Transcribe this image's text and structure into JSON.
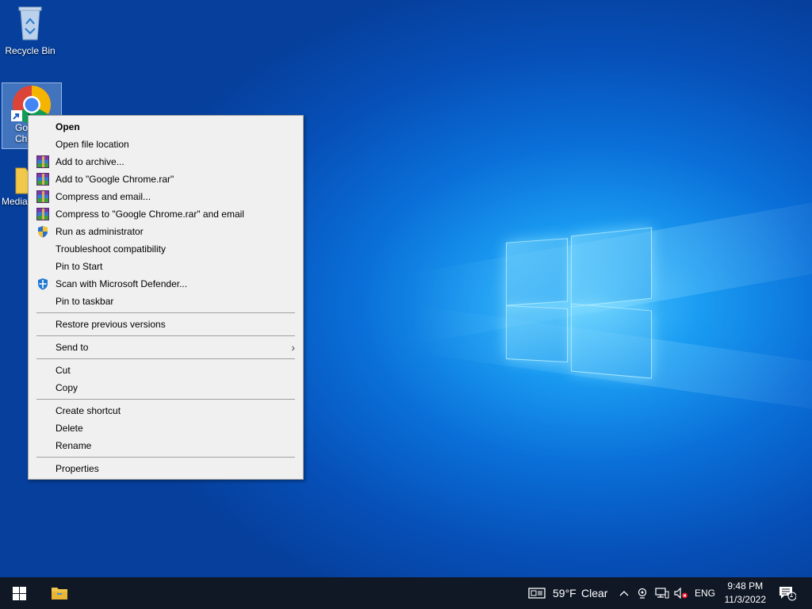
{
  "desktop": {
    "icons": [
      {
        "label": "Recycle Bin"
      },
      {
        "label": "Google Chrome",
        "label_visible": "Go\nChr"
      },
      {
        "label": "Media"
      }
    ]
  },
  "context_menu": {
    "groups": [
      [
        {
          "label": "Open",
          "bold": true
        },
        {
          "label": "Open file location"
        },
        {
          "label": "Add to archive...",
          "icon": "winrar-icon"
        },
        {
          "label": "Add to \"Google Chrome.rar\"",
          "icon": "winrar-icon"
        },
        {
          "label": "Compress and email...",
          "icon": "winrar-icon"
        },
        {
          "label": "Compress to \"Google Chrome.rar\" and email",
          "icon": "winrar-icon"
        },
        {
          "label": "Run as administrator",
          "icon": "uac-shield-icon"
        },
        {
          "label": "Troubleshoot compatibility"
        },
        {
          "label": "Pin to Start"
        },
        {
          "label": "Scan with Microsoft Defender...",
          "icon": "defender-icon"
        },
        {
          "label": "Pin to taskbar"
        }
      ],
      [
        {
          "label": "Restore previous versions"
        }
      ],
      [
        {
          "label": "Send to",
          "submenu": true
        }
      ],
      [
        {
          "label": "Cut"
        },
        {
          "label": "Copy"
        }
      ],
      [
        {
          "label": "Create shortcut"
        },
        {
          "label": "Delete"
        },
        {
          "label": "Rename"
        }
      ],
      [
        {
          "label": "Properties"
        }
      ]
    ]
  },
  "taskbar": {
    "weather_temp": "59°F",
    "weather_desc": "Clear",
    "language": "ENG",
    "time": "9:48 PM",
    "date": "11/3/2022",
    "notification_count": "1"
  },
  "colors": {
    "taskbar": "#101826",
    "menu_bg": "#f0f0f0",
    "accent": "#0078d7"
  }
}
